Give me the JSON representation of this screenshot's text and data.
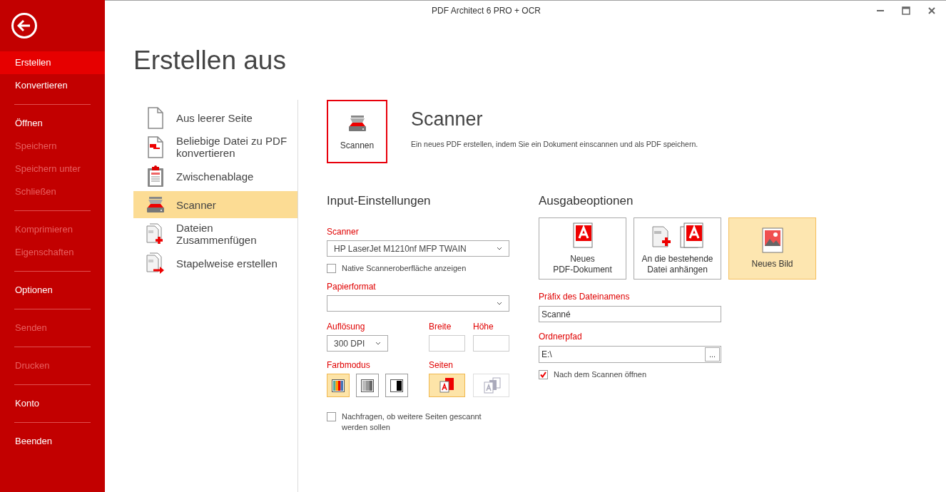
{
  "window": {
    "title": "PDF Architect 6 PRO + OCR"
  },
  "sidebar": {
    "groups": [
      [
        {
          "label": "Erstellen",
          "selected": true,
          "disabled": false
        },
        {
          "label": "Konvertieren",
          "selected": false,
          "disabled": false
        }
      ],
      [
        {
          "label": "Öffnen",
          "selected": false,
          "disabled": false
        },
        {
          "label": "Speichern",
          "selected": false,
          "disabled": true
        },
        {
          "label": "Speichern unter",
          "selected": false,
          "disabled": true
        },
        {
          "label": "Schließen",
          "selected": false,
          "disabled": true
        }
      ],
      [
        {
          "label": "Komprimieren",
          "selected": false,
          "disabled": true
        },
        {
          "label": "Eigenschaften",
          "selected": false,
          "disabled": true
        }
      ],
      [
        {
          "label": "Optionen",
          "selected": false,
          "disabled": false
        }
      ],
      [
        {
          "label": "Senden",
          "selected": false,
          "disabled": true
        }
      ],
      [
        {
          "label": "Drucken",
          "selected": false,
          "disabled": true
        }
      ],
      [
        {
          "label": "Konto",
          "selected": false,
          "disabled": false
        }
      ],
      [
        {
          "label": "Beenden",
          "selected": false,
          "disabled": false
        }
      ]
    ]
  },
  "page_title": "Erstellen aus",
  "create_from": [
    {
      "label": "Aus leerer Seite",
      "kind": "blank",
      "selected": false
    },
    {
      "label": "Beliebige Datei zu PDF\nkonvertieren",
      "kind": "convert",
      "selected": false
    },
    {
      "label": "Zwischenablage",
      "kind": "clipboard",
      "selected": false
    },
    {
      "label": "Scanner",
      "kind": "scanner",
      "selected": true
    },
    {
      "label": "Dateien\nZusammenfügen",
      "kind": "merge",
      "selected": false
    },
    {
      "label": "Stapelweise erstellen",
      "kind": "batch",
      "selected": false
    }
  ],
  "detail": {
    "action_button": "Scannen",
    "title": "Scanner",
    "description": "Ein neues PDF erstellen, indem Sie ein Dokument einscannen und als PDF speichern."
  },
  "input_settings": {
    "heading": "Input-Einstellungen",
    "scanner": {
      "label": "Scanner",
      "value": "HP LaserJet M1210nf MFP TWAIN"
    },
    "native_ui": {
      "label": "Native Scanneroberfläche anzeigen",
      "checked": false
    },
    "paper_format": {
      "label": "Papierformat"
    },
    "resolution": {
      "label": "Auflösung",
      "value": "300 DPI"
    },
    "width": {
      "label": "Breite"
    },
    "height": {
      "label": "Höhe"
    },
    "color_mode": {
      "label": "Farbmodus",
      "options": [
        {
          "kind": "color",
          "selected": true
        },
        {
          "kind": "gray",
          "selected": false
        },
        {
          "kind": "bw",
          "selected": false
        }
      ]
    },
    "pages": {
      "label": "Seiten",
      "options": [
        {
          "kind": "single",
          "selected": true,
          "disabled": false
        },
        {
          "kind": "multi",
          "selected": false,
          "disabled": true
        }
      ]
    },
    "ask_more": {
      "label": "Nachfragen, ob weitere Seiten gescannt\nwerden sollen",
      "checked": false
    }
  },
  "output": {
    "heading": "Ausgabeoptionen",
    "targets": [
      {
        "label": "Neues\nPDF-Dokument",
        "kind": "new_pdf",
        "selected": false
      },
      {
        "label": "An die bestehende\nDatei anhängen",
        "kind": "append",
        "selected": false
      },
      {
        "label": "Neues Bild",
        "kind": "image",
        "selected": true
      }
    ],
    "prefix": {
      "label": "Präfix des Dateinamens",
      "value": "Scanné"
    },
    "folder": {
      "label": "Ordnerpfad",
      "value": "E:\\",
      "browse": "..."
    },
    "open_after": {
      "label": "Nach dem Scannen öffnen",
      "checked": true
    }
  }
}
